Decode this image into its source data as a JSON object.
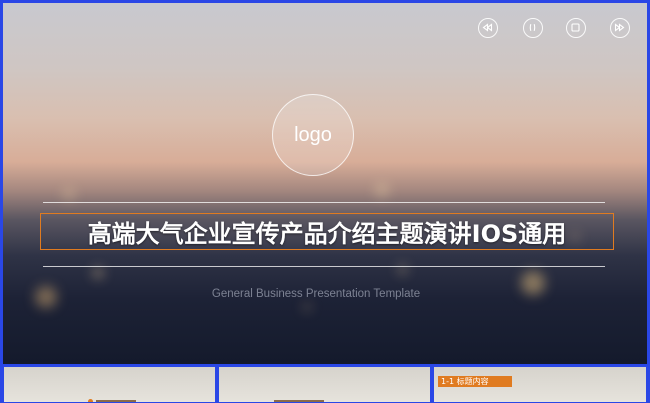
{
  "controls": {
    "rewind_icon": "rewind-icon",
    "pause_icon": "pause-icon",
    "stop_icon": "stop-icon",
    "fast_forward_icon": "fast-forward-icon"
  },
  "slide": {
    "logo_text": "logo",
    "title": "高端大气企业宣传产品介绍主题演讲IOS通用",
    "subtitle": "General Business Presentation Template"
  },
  "thumbnails": [
    {
      "label": ""
    },
    {
      "label": ""
    },
    {
      "label": "1-1 标题内容"
    }
  ],
  "colors": {
    "frame_border": "#2a47e6",
    "title_border": "#e07b20",
    "tag_background": "#e07b20"
  }
}
